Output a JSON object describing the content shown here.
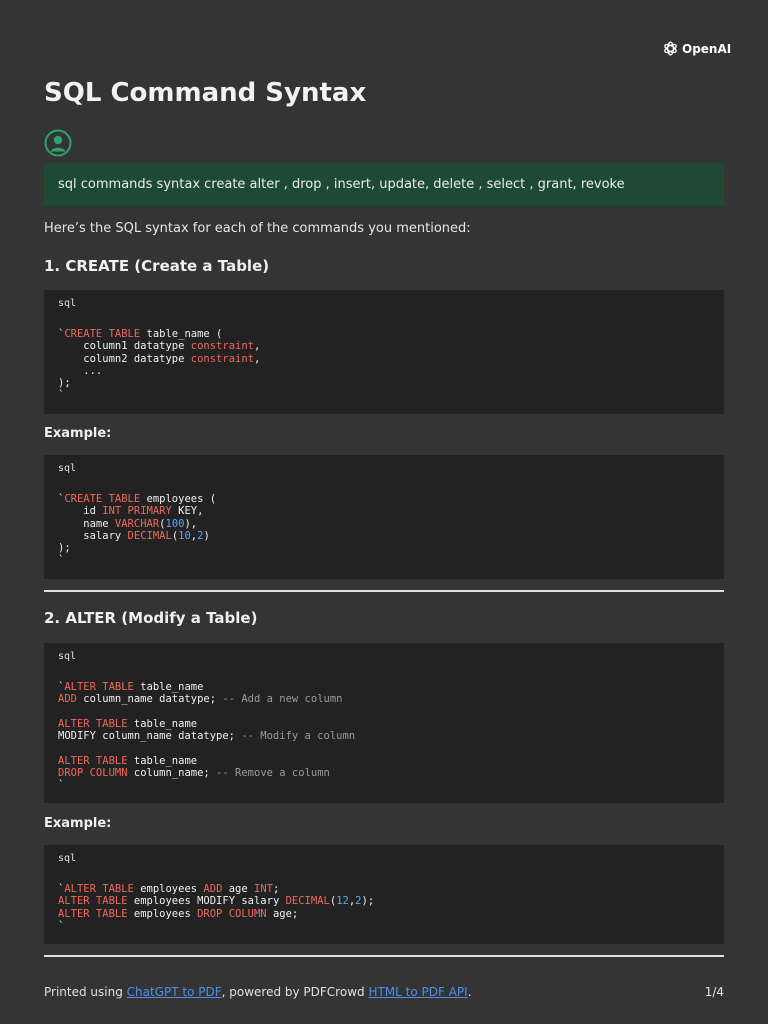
{
  "brand": {
    "name": "OpenAI"
  },
  "title": "SQL Command Syntax",
  "user_message": "sql commands syntax create alter , drop , insert, update, delete , select , grant, revoke",
  "intro": "Here’s the SQL syntax for each of the commands you mentioned:",
  "sections": {
    "create": {
      "heading": "1. CREATE (Create a Table)"
    },
    "alter": {
      "heading": "2. ALTER (Modify a Table)"
    }
  },
  "example_label": "Example:",
  "code_lang": "sql",
  "code": {
    "create_syntax": [
      [
        [
          "`",
          "p"
        ],
        [
          "CREATE TABLE",
          "kw"
        ],
        [
          " table_name (",
          "p"
        ]
      ],
      [
        [
          "    column1 datatype ",
          "p"
        ],
        [
          "constraint",
          "kw"
        ],
        [
          ",",
          "p"
        ]
      ],
      [
        [
          "    column2 datatype ",
          "p"
        ],
        [
          "constraint",
          "kw"
        ],
        [
          ",",
          "p"
        ]
      ],
      [
        [
          "    ...",
          "p"
        ]
      ],
      [
        [
          ");",
          "p"
        ]
      ],
      [
        [
          "`",
          "p"
        ]
      ]
    ],
    "create_example": [
      [
        [
          "`",
          "p"
        ],
        [
          "CREATE TABLE",
          "kw"
        ],
        [
          " employees (",
          "p"
        ]
      ],
      [
        [
          "    id ",
          "p"
        ],
        [
          "INT PRIMARY",
          "kw"
        ],
        [
          " KEY,",
          "p"
        ]
      ],
      [
        [
          "    name ",
          "p"
        ],
        [
          "VARCHAR",
          "kw"
        ],
        [
          "(",
          "p"
        ],
        [
          "100",
          "num"
        ],
        [
          "),",
          "p"
        ]
      ],
      [
        [
          "    salary ",
          "p"
        ],
        [
          "DECIMAL",
          "kw"
        ],
        [
          "(",
          "p"
        ],
        [
          "10",
          "num"
        ],
        [
          ",",
          "p"
        ],
        [
          "2",
          "num"
        ],
        [
          ")",
          "p"
        ]
      ],
      [
        [
          ");",
          "p"
        ]
      ],
      [
        [
          "`",
          "p"
        ]
      ]
    ],
    "alter_syntax": [
      [
        [
          "`",
          "p"
        ],
        [
          "ALTER TABLE",
          "kw"
        ],
        [
          " table_name",
          "p"
        ]
      ],
      [
        [
          "ADD",
          "kw"
        ],
        [
          " column_name datatype; ",
          "p"
        ],
        [
          "-- Add a new column",
          "cm"
        ]
      ],
      [
        [
          "",
          "p"
        ]
      ],
      [
        [
          "ALTER TABLE",
          "kw"
        ],
        [
          " table_name",
          "p"
        ]
      ],
      [
        [
          "MODIFY column_name datatype; ",
          "p"
        ],
        [
          "-- Modify a column",
          "cm"
        ]
      ],
      [
        [
          "",
          "p"
        ]
      ],
      [
        [
          "ALTER TABLE",
          "kw"
        ],
        [
          " table_name",
          "p"
        ]
      ],
      [
        [
          "DROP COLUMN",
          "kw"
        ],
        [
          " column_name; ",
          "p"
        ],
        [
          "-- Remove a column",
          "cm"
        ]
      ],
      [
        [
          "`",
          "p"
        ]
      ]
    ],
    "alter_example": [
      [
        [
          "`",
          "p"
        ],
        [
          "ALTER TABLE",
          "kw"
        ],
        [
          " employees ",
          "p"
        ],
        [
          "ADD",
          "kw"
        ],
        [
          " age ",
          "p"
        ],
        [
          "INT",
          "kw"
        ],
        [
          ";",
          "p"
        ]
      ],
      [
        [
          "ALTER TABLE",
          "kw"
        ],
        [
          " employees MODIFY salary ",
          "p"
        ],
        [
          "DECIMAL",
          "kw"
        ],
        [
          "(",
          "p"
        ],
        [
          "12",
          "num"
        ],
        [
          ",",
          "p"
        ],
        [
          "2",
          "num"
        ],
        [
          ");",
          "p"
        ]
      ],
      [
        [
          "ALTER TABLE",
          "kw"
        ],
        [
          " employees ",
          "p"
        ],
        [
          "DROP COLUMN",
          "kw"
        ],
        [
          " age;",
          "p"
        ]
      ],
      [
        [
          "`",
          "p"
        ]
      ]
    ]
  },
  "footer": {
    "prefix": "Printed using ",
    "link1": "ChatGPT to PDF",
    "middle": ", powered by PDFCrowd ",
    "link2": "HTML to PDF API",
    "suffix": ".",
    "page": "1/4"
  },
  "colors": {
    "background": "#343434",
    "user_bubble": "#1e4a33",
    "code_bg": "#222222",
    "keyword": "#f0675e",
    "number": "#5aa8ef",
    "comment": "#9a9a9a",
    "link": "#4f8fe8",
    "avatar": "#2fa36b"
  }
}
